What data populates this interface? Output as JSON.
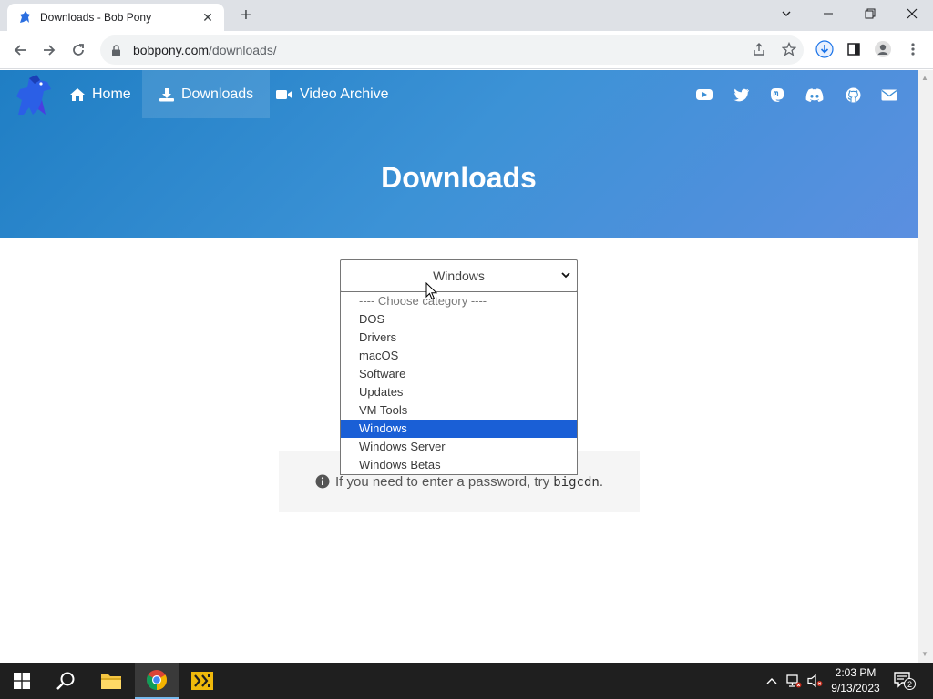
{
  "browser": {
    "tab_title": "Downloads - Bob Pony",
    "url_host": "bobpony.com",
    "url_path": "/downloads/"
  },
  "nav": {
    "home": "Home",
    "downloads": "Downloads",
    "video_archive": "Video Archive"
  },
  "hero": {
    "title": "Downloads"
  },
  "category_select": {
    "selected": "Windows",
    "options": [
      "---- Choose category ----",
      "DOS",
      "Drivers",
      "macOS",
      "Software",
      "Updates",
      "VM Tools",
      "Windows",
      "Windows Server",
      "Windows Betas"
    ],
    "selected_index": 7
  },
  "info": {
    "text": "If you need to enter a password, try ",
    "code": "bigcdn",
    "suffix": "."
  },
  "taskbar": {
    "time": "2:03 PM",
    "date": "9/13/2023",
    "notification_count": "2"
  },
  "colors": {
    "hero_start": "#1f7ec4",
    "hero_end": "#5b8fe0",
    "selected_option": "#1a5fd6"
  }
}
